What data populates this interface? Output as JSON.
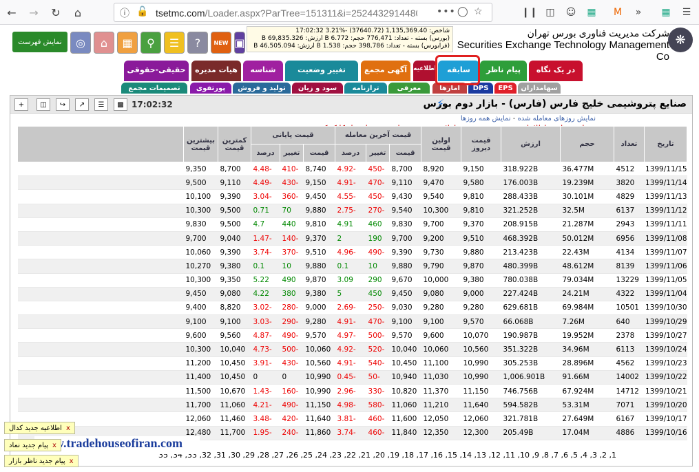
{
  "browser": {
    "url_main": "tsetmc.com",
    "url_rest": "/Loader.aspx?ParTree=151311&i=25244329144808",
    "menu_dots": "•••"
  },
  "header": {
    "show_list": "نمایش فهرست",
    "index_lines": [
      "شاخص: 1,135,369.40 (37640.72) -%3.21 17:02:32",
      "(بورس) بسته - تعداد: 776,471 حجم: 6.772 B ارزش: 69,835.326 B",
      "(فرابورس) بسته - تعداد: 398,786 حجم: 1.538 B ارزش: 46,505.094 B"
    ],
    "brand_fa": "شرکت مدیریت فناوری بورس تهران",
    "brand_en": "Securities Exchange Technology Management Co",
    "new_badge": "NEW"
  },
  "tabs_row1": [
    {
      "label": "در یک نگاه",
      "color": "#c8102e"
    },
    {
      "label": "پیام ناظر",
      "color": "#2e9e3a"
    },
    {
      "label": "سابقه",
      "color": "#1e9fd6"
    },
    {
      "label": "اطلاعیه",
      "color": "#b01030"
    },
    {
      "label": "آگهی مجمع",
      "color": "#e07010"
    },
    {
      "label": "تغییر وضعیت",
      "color": "#1a8a9a"
    },
    {
      "label": "شناسه",
      "color": "#a020a0"
    },
    {
      "label": "هیات مدیره",
      "color": "#7a2a2a"
    },
    {
      "label": "حقیقی-حقوقی",
      "color": "#8a1a9a"
    }
  ],
  "tabs_row2": [
    {
      "label": "سهامداران",
      "color": "#a0a0a0"
    },
    {
      "label": "EPS",
      "color": "#e0202a"
    },
    {
      "label": "DPS",
      "color": "#1a3aa0"
    },
    {
      "label": "آمارها",
      "color": "#c04040"
    },
    {
      "label": "معرفی",
      "color": "#3a9a3a"
    },
    {
      "label": "ترازنامه",
      "color": "#1a8a9a"
    },
    {
      "label": "سود و زیان",
      "color": "#a01040"
    },
    {
      "label": "تولید و فروش",
      "color": "#2a6a9a"
    },
    {
      "label": "پورتفوی",
      "color": "#8a1aaa"
    },
    {
      "label": "تصمیمات مجمع",
      "color": "#1a8a7a"
    }
  ],
  "panel": {
    "title": "صنایع پتروشیمی خلیج فارس (فارس) - بازار دوم بورس",
    "time": "17:02:32",
    "link_traded": "نمایش روزهای معامله شده",
    "link_all": "نمایش همه روزها",
    "note": "- برای مشاهده اطلاعات بیشتر در هر روز معاملاتی بر روی سطر مورد نظر دبل کلیک کنید"
  },
  "columns": {
    "date": "تاریخ",
    "count": "تعداد",
    "volume": "حجم",
    "value": "ارزش",
    "yday": "قیمت دیروز",
    "first": "اولین قیمت",
    "last_group": "قیمت آخرین معامله",
    "final_group": "قیمت پایانی",
    "price": "قیمت",
    "change": "تغییر",
    "pct": "درصد",
    "min": "کمترین قیمت",
    "max": "بیشترین قیمت"
  },
  "rows": [
    [
      "1399/11/15",
      "4512",
      "36.477M",
      "318.922B",
      "9,150",
      "8,920",
      "8,700",
      "-450",
      "-4.92",
      "8,740",
      "-410",
      "-4.48",
      "8,700",
      "9,350"
    ],
    [
      "1399/11/14",
      "3820",
      "19.239M",
      "176.003B",
      "9,580",
      "9,470",
      "9,110",
      "-470",
      "-4.91",
      "9,150",
      "-430",
      "-4.49",
      "9,110",
      "9,500"
    ],
    [
      "1399/11/13",
      "4829",
      "30.101M",
      "288.433B",
      "9,810",
      "9,540",
      "9,430",
      "-450",
      "-4.55",
      "9,450",
      "-360",
      "-3.04",
      "9,390",
      "10,100"
    ],
    [
      "1399/11/12",
      "6137",
      "32.5M",
      "321.252B",
      "9,810",
      "10,300",
      "9,540",
      "-270",
      "-2.75",
      "9,880",
      "70",
      "0.71",
      "9,500",
      "10,300"
    ],
    [
      "1399/11/11",
      "2943",
      "21.287M",
      "208.915B",
      "9,370",
      "9,700",
      "9,830",
      "460",
      "4.91",
      "9,810",
      "440",
      "4.7",
      "9,500",
      "9,830"
    ],
    [
      "1399/11/08",
      "6956",
      "50.012M",
      "468.392B",
      "9,510",
      "9,200",
      "9,700",
      "190",
      "2",
      "9,370",
      "-140",
      "-1.47",
      "9,040",
      "9,700"
    ],
    [
      "1399/11/07",
      "4134",
      "22.43M",
      "213.423B",
      "9,880",
      "9,730",
      "9,390",
      "-490",
      "-4.96",
      "9,510",
      "-370",
      "-3.74",
      "9,390",
      "10,060"
    ],
    [
      "1399/11/06",
      "8139",
      "48.612M",
      "480.399B",
      "9,870",
      "9,790",
      "9,880",
      "10",
      "0.1",
      "9,880",
      "10",
      "0.1",
      "9,380",
      "10,270"
    ],
    [
      "1399/11/05",
      "13229",
      "79.034M",
      "780.038B",
      "9,380",
      "10,000",
      "9,670",
      "290",
      "3.09",
      "9,870",
      "490",
      "5.22",
      "9,350",
      "10,300"
    ],
    [
      "1399/11/04",
      "4322",
      "24.21M",
      "227.424B",
      "9,000",
      "9,080",
      "9,450",
      "450",
      "5",
      "9,380",
      "380",
      "4.22",
      "9,080",
      "9,450"
    ],
    [
      "1399/10/30",
      "10501",
      "69.984M",
      "629.681B",
      "9,280",
      "9,280",
      "9,030",
      "-250",
      "-2.69",
      "9,000",
      "-280",
      "-3.02",
      "8,820",
      "9,400"
    ],
    [
      "1399/10/29",
      "640",
      "7.26M",
      "66.068B",
      "9,570",
      "9,100",
      "9,100",
      "-470",
      "-4.91",
      "9,280",
      "-290",
      "-3.03",
      "9,100",
      "9,100"
    ],
    [
      "1399/10/27",
      "2378",
      "19.952M",
      "190.987B",
      "10,070",
      "9,600",
      "9,570",
      "-500",
      "-4.97",
      "9,570",
      "-490",
      "-4.87",
      "9,560",
      "9,600"
    ],
    [
      "1399/10/24",
      "6113",
      "34.96M",
      "351.322B",
      "10,560",
      "10,060",
      "10,040",
      "-520",
      "-4.92",
      "10,060",
      "-500",
      "-4.73",
      "10,040",
      "10,300"
    ],
    [
      "1399/10/23",
      "4562",
      "28.896M",
      "305.253B",
      "10,990",
      "11,100",
      "10,450",
      "-540",
      "-4.91",
      "10,560",
      "-430",
      "-3.91",
      "10,450",
      "11,200"
    ],
    [
      "1399/10/22",
      "14002",
      "91.66M",
      "1,006.901B",
      "10,990",
      "11,030",
      "10,940",
      "-50",
      "-0.45",
      "10,990",
      "0",
      "0",
      "10,450",
      "11,400"
    ],
    [
      "1399/10/21",
      "14712",
      "67.924M",
      "746.756B",
      "11,150",
      "11,370",
      "10,820",
      "-330",
      "-2.96",
      "10,990",
      "-160",
      "-1.43",
      "10,670",
      "11,500"
    ],
    [
      "1399/10/20",
      "7071",
      "53.31M",
      "594.582B",
      "11,640",
      "11,210",
      "11,060",
      "-580",
      "-4.98",
      "11,150",
      "-490",
      "-4.21",
      "11,060",
      "11,700"
    ],
    [
      "1399/10/17",
      "6167",
      "27.649M",
      "321.781B",
      "12,060",
      "12,050",
      "11,600",
      "-460",
      "-3.81",
      "11,640",
      "-420",
      "-3.48",
      "11,460",
      "12,060"
    ],
    [
      "1399/10/16",
      "4886",
      "17.04M",
      "205.49B",
      "12,300",
      "12,350",
      "11,840",
      "-460",
      "-3.74",
      "11,860",
      "-240",
      "-1.95",
      "11,700",
      "12,480"
    ]
  ],
  "pager": "1, 2, 3, 4, 5, 6, 7, 8, 9, 10, 11, 12, 13, 14, 15, 16, 17, 18, 19, 20, 21, 22, 23, 24, 25, 26, 27, 28, 29, 30, 31, 32, 33, 34, 35",
  "watermark": "www.tradehouseofiran.com",
  "notifications": [
    {
      "text": "اطلاعیه جدید کدال",
      "close": "x"
    },
    {
      "text": "پیام جدید نماد",
      "close": "x"
    },
    {
      "text": "پیام جدید ناظر بازار",
      "close": "x"
    }
  ]
}
